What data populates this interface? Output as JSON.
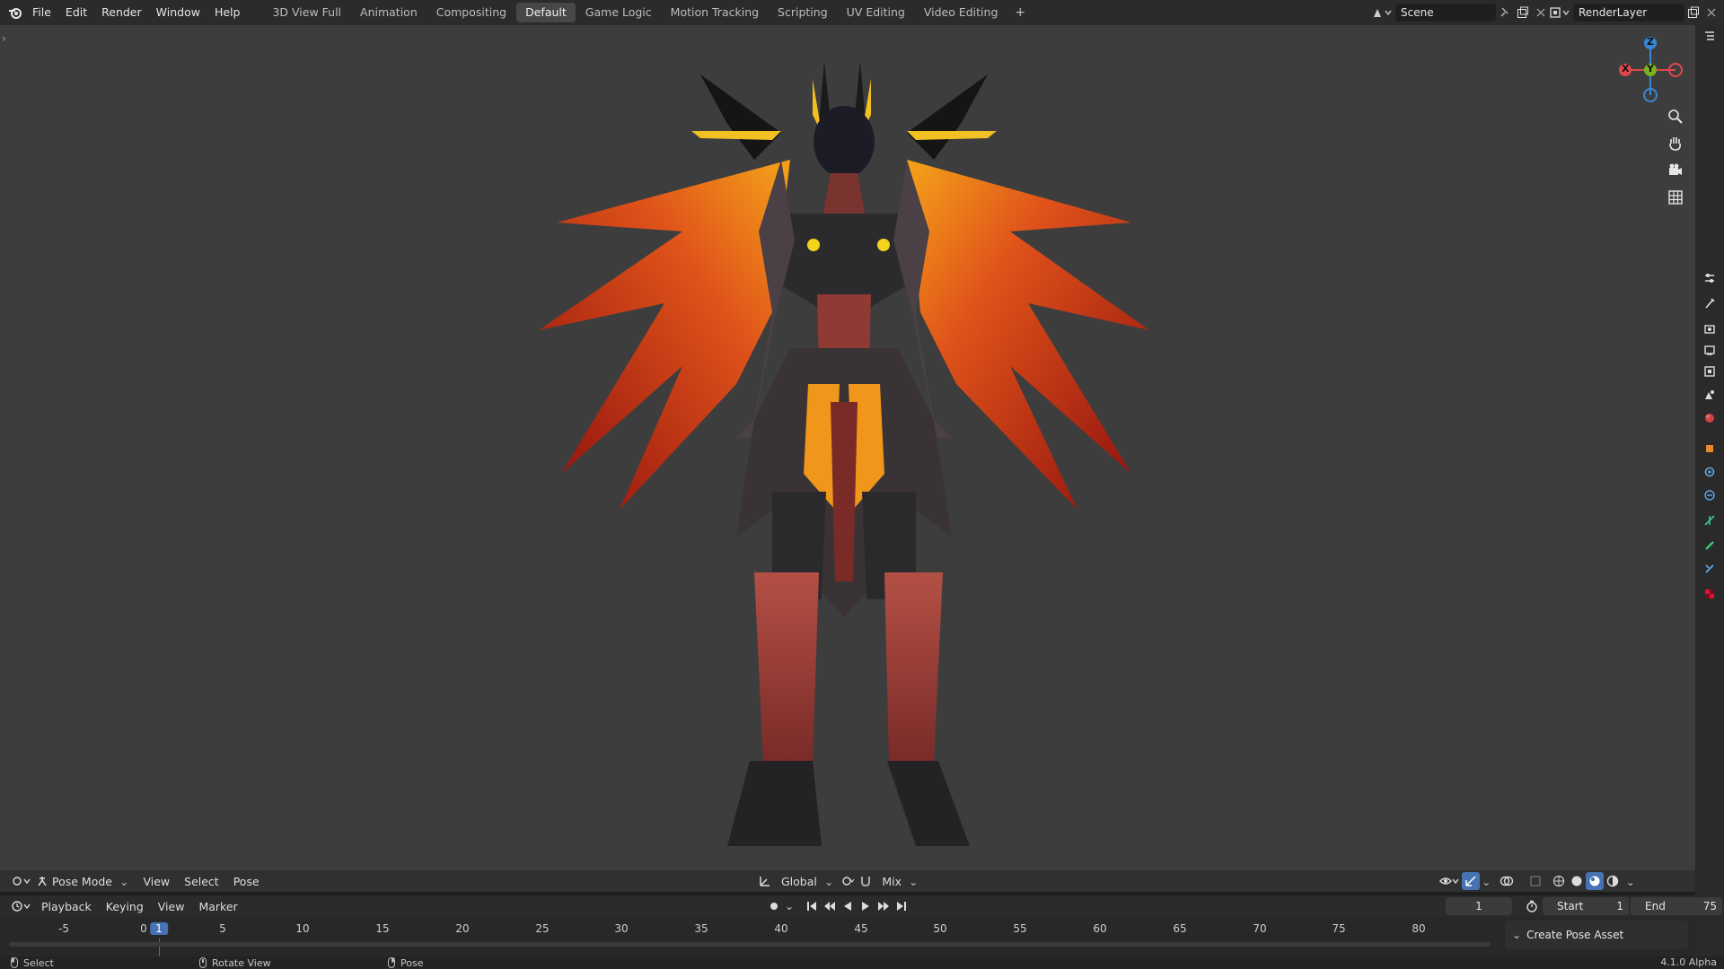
{
  "menu": {
    "items": [
      "File",
      "Edit",
      "Render",
      "Window",
      "Help"
    ]
  },
  "workspaces": {
    "tabs": [
      "3D View Full",
      "Animation",
      "Compositing",
      "Default",
      "Game Logic",
      "Motion Tracking",
      "Scripting",
      "UV Editing",
      "Video Editing"
    ],
    "active": "Default",
    "add_label": "+"
  },
  "scene": {
    "name": "Scene"
  },
  "render_layer": {
    "name": "RenderLayer"
  },
  "viewport": {
    "gizmo": {
      "x": "X",
      "y": "Y",
      "z": "Z"
    },
    "colors": {
      "x": "#e0464e",
      "y": "#79b321",
      "z": "#3a86d4",
      "background": "#3d3d3d"
    }
  },
  "header": {
    "mode": "Pose Mode",
    "view": "View",
    "select": "Select",
    "pose": "Pose",
    "orientation": "Global",
    "blend": "Mix"
  },
  "timeline": {
    "playback": "Playback",
    "keying": "Keying",
    "view": "View",
    "marker": "Marker",
    "current_frame": "1",
    "start_label": "Start",
    "start_value": "1",
    "end_label": "End",
    "end_value": "75",
    "ticks": [
      "-5",
      "0",
      "1",
      "5",
      "10",
      "15",
      "20",
      "25",
      "30",
      "35",
      "40",
      "45",
      "50",
      "55",
      "60",
      "65",
      "70",
      "75",
      "80"
    ],
    "create_pose_asset": "Create Pose Asset"
  },
  "status": {
    "select": "Select",
    "rotate": "Rotate View",
    "pose": "Pose",
    "version": "4.1.0 Alpha"
  }
}
